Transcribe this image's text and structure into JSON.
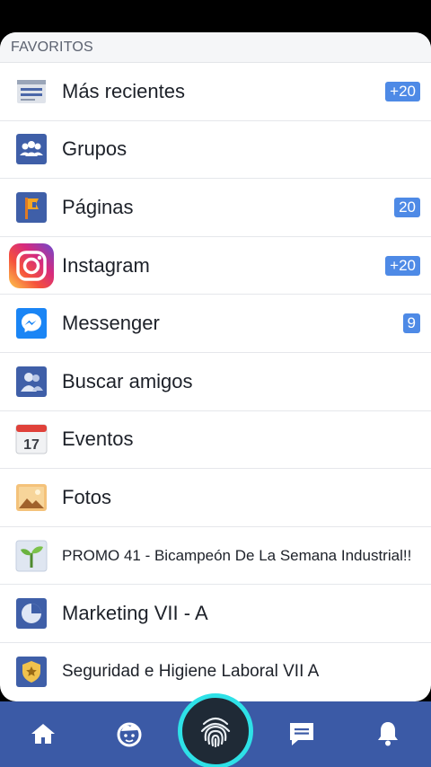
{
  "section": {
    "title": "FAVORITOS"
  },
  "items": [
    {
      "label": "Más recientes",
      "badge": "+20",
      "icon": "news-feed-icon"
    },
    {
      "label": "Grupos",
      "badge": "",
      "icon": "groups-icon"
    },
    {
      "label": "Páginas",
      "badge": "20",
      "icon": "pages-flag-icon"
    },
    {
      "label": "Instagram",
      "badge": "+20",
      "icon": "instagram-icon"
    },
    {
      "label": "Messenger",
      "badge": "9",
      "icon": "messenger-icon"
    },
    {
      "label": "Buscar amigos",
      "badge": "",
      "icon": "find-friends-icon"
    },
    {
      "label": "Eventos",
      "badge": "",
      "icon": "calendar-icon",
      "icon_text": "17"
    },
    {
      "label": "Fotos",
      "badge": "",
      "icon": "photos-icon"
    },
    {
      "label": "PROMO 41 - Bicampeón De La Semana Industrial!!",
      "badge": "",
      "icon": "sprout-group-icon"
    },
    {
      "label": "Marketing VII - A",
      "badge": "",
      "icon": "pie-chart-group-icon"
    },
    {
      "label": "Seguridad e Higiene Laboral VII A",
      "badge": "",
      "icon": "badge-shield-group-icon"
    }
  ],
  "nav": {
    "home": "home-icon",
    "face": "face-icon",
    "fingerprint": "fingerprint-icon",
    "messages": "chat-icon",
    "notifications": "bell-icon"
  },
  "colors": {
    "badge": "#4e8ae6",
    "nav_bg": "#3b5aa6",
    "fingerprint_ring": "#2ee1e7"
  }
}
